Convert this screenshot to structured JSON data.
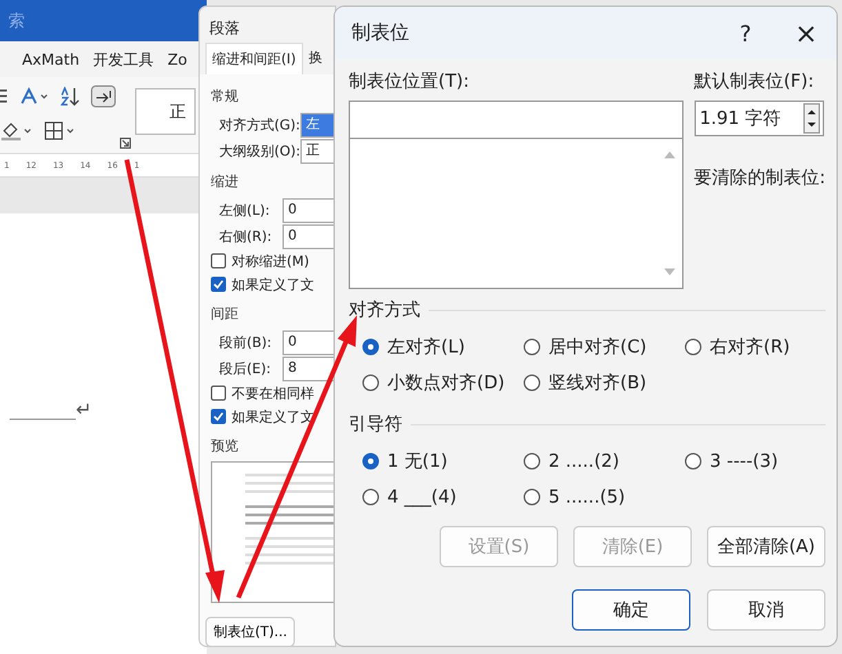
{
  "word": {
    "search_text": "索",
    "ribbon_tabs": [
      "AxMath",
      "开发工具",
      "Zo"
    ],
    "style_preview": "正",
    "ruler_numbers": [
      "1",
      "12",
      "13",
      "14",
      "16",
      "1"
    ],
    "paragraph_mark": "↵"
  },
  "paragraph_dialog": {
    "title": "段落",
    "tabs": [
      {
        "label": "缩进和间距(I)",
        "selected": true
      },
      {
        "label": "换",
        "selected": false
      }
    ],
    "sections": [
      {
        "title": "常规",
        "rows": [
          {
            "kind": "field",
            "label": "对齐方式(G):",
            "value": "左",
            "highlighted": true
          },
          {
            "kind": "field",
            "label": "大纲级别(O):",
            "value": "正",
            "highlighted": false
          }
        ]
      },
      {
        "title": "缩进",
        "rows": [
          {
            "kind": "field",
            "label": "左侧(L):",
            "value": "0",
            "highlighted": false
          },
          {
            "kind": "field",
            "label": "右侧(R):",
            "value": "0",
            "highlighted": false
          },
          {
            "kind": "checkbox",
            "label": "对称缩进(M)",
            "checked": false
          },
          {
            "kind": "checkbox",
            "label": "如果定义了文",
            "checked": true
          }
        ]
      },
      {
        "title": "间距",
        "rows": [
          {
            "kind": "field",
            "label": "段前(B):",
            "value": "0",
            "highlighted": false
          },
          {
            "kind": "field",
            "label": "段后(E):",
            "value": "8",
            "highlighted": false
          },
          {
            "kind": "checkbox",
            "label": "不要在相同样",
            "checked": false
          },
          {
            "kind": "checkbox",
            "label": "如果定义了文",
            "checked": true
          }
        ]
      }
    ],
    "preview_label": "预览",
    "tab_button": "制表位(T)..."
  },
  "tabs_dialog": {
    "title": "制表位",
    "help": "?",
    "close": "×",
    "position_label": "制表位位置(T):",
    "default_label": "默认制表位(F):",
    "default_value": "1.91 字符",
    "clear_label": "要清除的制表位:",
    "alignment": {
      "title": "对齐方式",
      "options": [
        {
          "label": "左对齐(L)",
          "selected": true
        },
        {
          "label": "居中对齐(C)",
          "selected": false
        },
        {
          "label": "右对齐(R)",
          "selected": false
        },
        {
          "label": "小数点对齐(D)",
          "selected": false
        },
        {
          "label": "竖线对齐(B)",
          "selected": false
        }
      ]
    },
    "leader": {
      "title": "引导符",
      "options": [
        {
          "label": "1 无(1)",
          "selected": true
        },
        {
          "label": "2 .....(2)",
          "selected": false
        },
        {
          "label": "3 ----(3)",
          "selected": false
        },
        {
          "label": "4 ___(4)",
          "selected": false
        },
        {
          "label": "5 ......(5)",
          "selected": false
        }
      ]
    },
    "buttons": [
      {
        "label": "设置(S)",
        "disabled": true
      },
      {
        "label": "清除(E)",
        "disabled": true
      },
      {
        "label": "全部清除(A)",
        "disabled": false
      }
    ],
    "footer_buttons": [
      {
        "label": "确定",
        "default": true
      },
      {
        "label": "取消",
        "default": false
      }
    ]
  }
}
